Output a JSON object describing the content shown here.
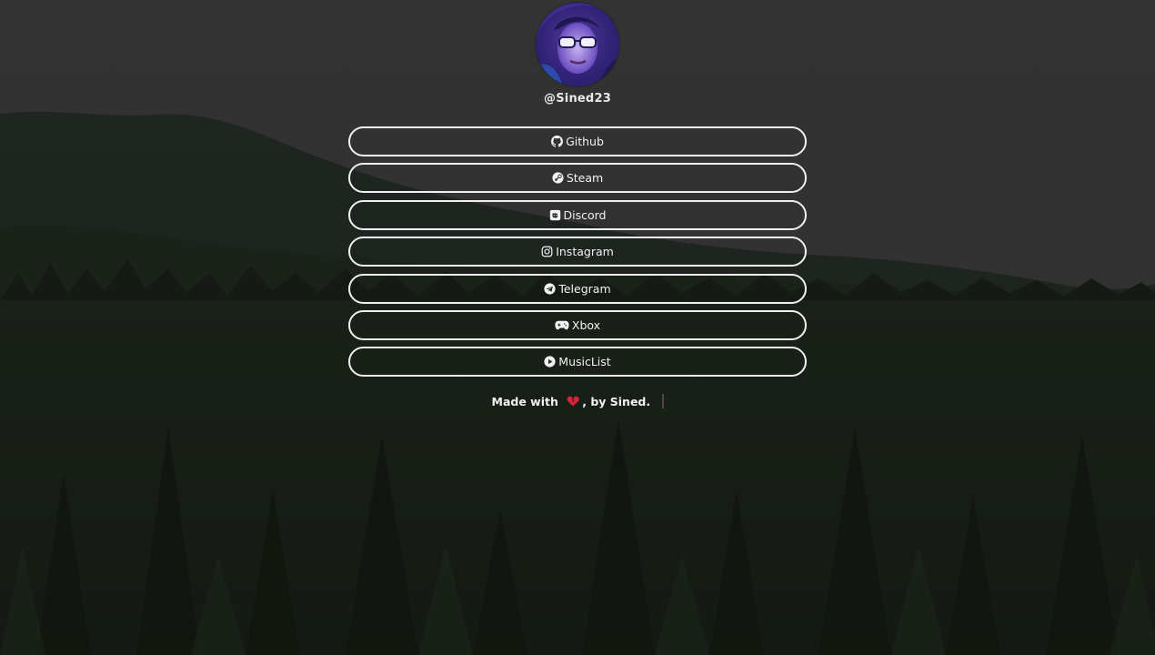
{
  "profile": {
    "username": "@Sined23",
    "avatar_icon": "avatar-portrait"
  },
  "links": [
    {
      "label": "Github",
      "icon": "github-icon"
    },
    {
      "label": "Steam",
      "icon": "steam-icon"
    },
    {
      "label": "Discord",
      "icon": "discord-icon"
    },
    {
      "label": "Instagram",
      "icon": "instagram-icon"
    },
    {
      "label": "Telegram",
      "icon": "telegram-icon"
    },
    {
      "label": "Xbox",
      "icon": "gamepad-icon"
    },
    {
      "label": "MusicList",
      "icon": "play-circle-icon"
    }
  ],
  "footer": {
    "prefix": "Made with",
    "suffix": ", by Sined.",
    "heart_icon": "broken-heart-icon"
  },
  "colors": {
    "background": "#323232",
    "text": "#f2f2f2",
    "button_border": "#f0f0f0",
    "heart": "#d8233a"
  }
}
